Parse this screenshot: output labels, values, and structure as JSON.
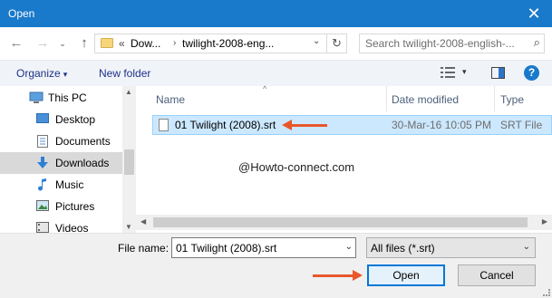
{
  "window": {
    "title": "Open",
    "close_glyph": "✕"
  },
  "nav": {
    "back_glyph": "←",
    "forward_glyph": "→",
    "recent_glyph": "⌄",
    "up_glyph": "↑",
    "address_chevron": "«",
    "address_segments": [
      "Dow...",
      "twilight-2008-eng..."
    ],
    "address_separator": "›",
    "address_dropdown": "⌄",
    "refresh_glyph": "↻",
    "search_placeholder": "Search twilight-2008-english-...",
    "search_glyph": "⌕"
  },
  "toolbar": {
    "organize_label": "Organize",
    "organize_arrow": "▾",
    "new_folder_label": "New folder",
    "view_arrow": "▾",
    "help_label": "?"
  },
  "sidebar": {
    "items": [
      {
        "label": "This PC",
        "icon": "pc-icon"
      },
      {
        "label": "Desktop",
        "icon": "desktop-icon"
      },
      {
        "label": "Documents",
        "icon": "documents-icon"
      },
      {
        "label": "Downloads",
        "icon": "downloads-icon",
        "selected": true
      },
      {
        "label": "Music",
        "icon": "music-icon"
      },
      {
        "label": "Pictures",
        "icon": "pictures-icon"
      },
      {
        "label": "Videos",
        "icon": "videos-icon"
      }
    ],
    "scroll_up": "▲",
    "scroll_down": "▼"
  },
  "filelist": {
    "columns": [
      "Name",
      "Date modified",
      "Type"
    ],
    "sort_arrow": "^",
    "rows": [
      {
        "name": "01 Twilight (2008).srt",
        "date": "30-Mar-16 10:05 PM",
        "type": "SRT File",
        "selected": true
      }
    ],
    "watermark": "@Howto-connect.com",
    "scroll_left": "◀",
    "scroll_right": "▶"
  },
  "footer": {
    "file_name_label": "File name:",
    "file_name_value": "01 Twilight (2008).srt",
    "file_name_dropdown": "⌄",
    "filter_value": "All files (*.srt)",
    "filter_dropdown": "⌄",
    "open_label": "Open",
    "cancel_label": "Cancel"
  },
  "colors": {
    "titlebar": "#1979ca",
    "selection": "#cce8ff",
    "annotation_arrow": "#e8572a",
    "default_button_border": "#0078d7"
  }
}
